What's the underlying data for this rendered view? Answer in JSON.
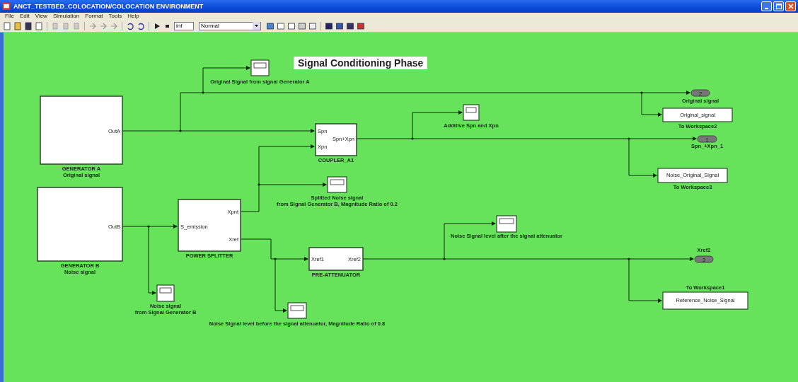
{
  "window": {
    "title": "ANCT_TESTBED_COLOCATION/COLOCATION ENVIRONMENT"
  },
  "menu": [
    {
      "label": "File"
    },
    {
      "label": "Edit"
    },
    {
      "label": "View"
    },
    {
      "label": "Simulation"
    },
    {
      "label": "Format"
    },
    {
      "label": "Tools"
    },
    {
      "label": "Help"
    }
  ],
  "toolbar": {
    "stop_time": "inf",
    "mode": "Normal"
  },
  "diagram": {
    "title": "Signal Conditioning Phase",
    "blocks": [
      {
        "kind": "scope",
        "caption": [
          "Original Signal from signal Generator A"
        ]
      },
      {
        "kind": "outport",
        "number": "2",
        "caption": [
          "Original signal"
        ]
      },
      {
        "kind": "subsystem",
        "outputs": [
          "OutA"
        ],
        "caption": [
          "GENERATOR A",
          "Original signal"
        ]
      },
      {
        "kind": "scope",
        "caption": [
          "Additive Spn and Xpn"
        ]
      },
      {
        "kind": "workspace",
        "variable": "Original_signal",
        "caption": [
          "To Workspace2"
        ]
      },
      {
        "kind": "subsystem",
        "inputs": [
          "Spn",
          "Xpn"
        ],
        "outputs": [
          "Spn+Xpn"
        ],
        "caption": [
          "COUPLER_A1"
        ]
      },
      {
        "kind": "outport",
        "number": "1",
        "caption": [
          "Spn_+Xpn_1"
        ]
      },
      {
        "kind": "workspace",
        "variable": "Noise_Original_Signal",
        "caption": [
          "To Workspace3"
        ]
      },
      {
        "kind": "scope",
        "caption": [
          "Splitted Noise signal",
          "from Signal Generator B,  Magnitude  Ratio of 0.2"
        ]
      },
      {
        "kind": "subsystem",
        "outputs": [
          "OutB"
        ],
        "caption": [
          "GENERATOR B",
          "Noise signal"
        ]
      },
      {
        "kind": "subsystem",
        "inputs": [
          "S_emission"
        ],
        "outputs": [
          "Xpnt",
          "Xref"
        ],
        "caption": [
          "POWER SPLITTER"
        ]
      },
      {
        "kind": "scope",
        "caption": [
          "Noise Signal level after the signal attenuator"
        ]
      },
      {
        "kind": "subsystem",
        "inputs": [
          "Xref1"
        ],
        "outputs": [
          "Xref2"
        ],
        "caption": [
          "PRE-ATTENUATOR"
        ]
      },
      {
        "kind": "outport",
        "number": "3",
        "caption": [
          "Xref2"
        ]
      },
      {
        "kind": "scope",
        "caption": [
          "Noise signal",
          "from Signal Generator B"
        ]
      },
      {
        "kind": "workspace",
        "variable": "Reference_Noise_Signal",
        "caption": [
          "To Workspace1"
        ]
      },
      {
        "kind": "scope",
        "caption": [
          "Noise Signal level before the signal attenuator, Magnitude Ratio of 0.8"
        ]
      }
    ]
  }
}
